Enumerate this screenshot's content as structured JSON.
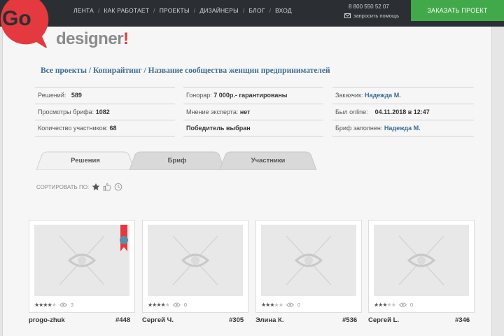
{
  "nav": {
    "items": [
      "ЛЕНТА",
      "КАК РАБОТАЕТ",
      "ПРОЕКТЫ",
      "ДИЗАЙНЕРЫ",
      "БЛОГ",
      "ВХОД"
    ]
  },
  "header": {
    "phone": "8 800 550 52 07",
    "help": "запросить помощь",
    "order_button": "ЗАКАЗАТЬ ПРОЕКТ",
    "logo_go": "Go",
    "logo_word": "designer",
    "logo_bang": "!"
  },
  "breadcrumb": {
    "items": [
      "Все проекты",
      "Копирайтинг",
      "Название сообщества женщин предпринимателей"
    ],
    "separator": " / "
  },
  "info": {
    "col1": {
      "solutions_label": "Решений:",
      "solutions_value": "589",
      "views_label": "Просмотры брифа:",
      "views_value": "1082",
      "participants_label": "Количество участников:",
      "participants_value": "68"
    },
    "col2": {
      "fee_label": "Гонорар:",
      "fee_value": "7 000р.- гарантированы",
      "expert_label": "Мнение эксперта:",
      "expert_value": "нет",
      "winner": "Победитель выбран"
    },
    "col3": {
      "customer_label": "Заказчик:",
      "customer_value": "Надежда М.",
      "online_label": "Был online:",
      "online_value": "04.11.2018 в 12:47",
      "brief_label": "Бриф заполнен:",
      "brief_value": "Надежда М."
    }
  },
  "tabs": [
    "Решения",
    "Бриф",
    "Участники"
  ],
  "sort": {
    "label": "СОРТИРОВАТЬ ПО:"
  },
  "cards": [
    {
      "name": "progo-zhuk",
      "number": "#448",
      "rating": 4,
      "views": "3",
      "winner": true
    },
    {
      "name": "Сергей Ч.",
      "number": "#305",
      "rating": 4,
      "views": "0",
      "winner": false
    },
    {
      "name": "Элина К.",
      "number": "#536",
      "rating": 3,
      "views": "0",
      "winner": false
    },
    {
      "name": "Сергей L.",
      "number": "#346",
      "rating": 3,
      "views": "0",
      "winner": false
    }
  ],
  "colors": {
    "accent_green": "#41a94a",
    "brand_red": "#e3393f",
    "link_blue": "#3c6a93",
    "topbar": "#2b2f33"
  }
}
